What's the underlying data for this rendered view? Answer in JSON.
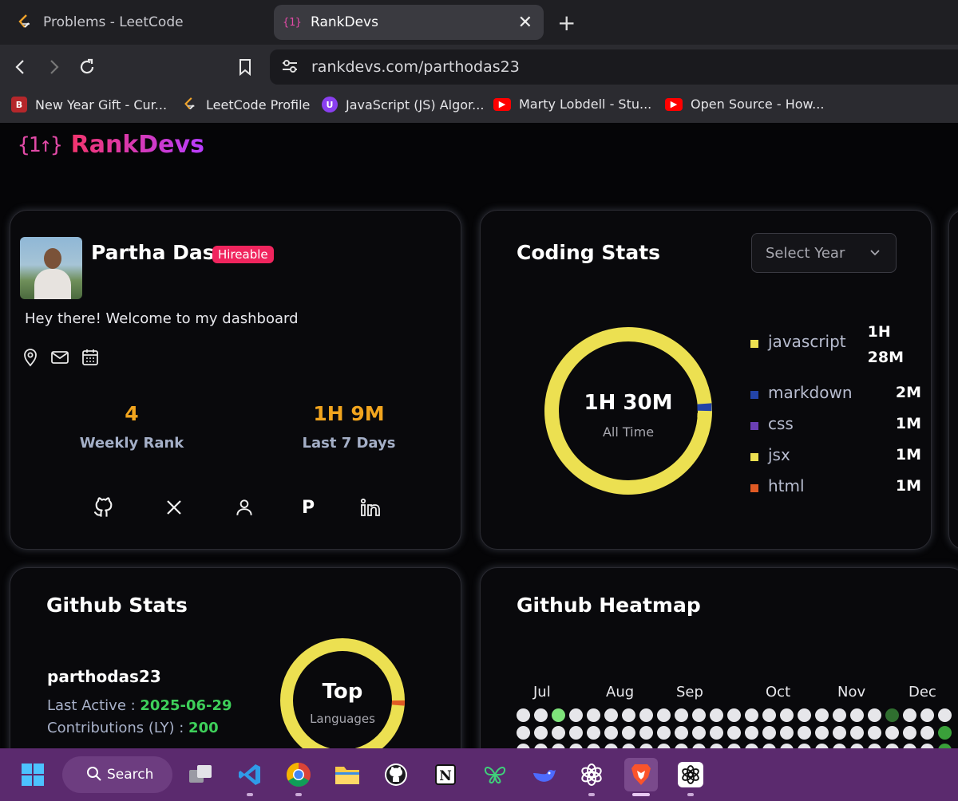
{
  "browser": {
    "tabs": [
      {
        "title": "Problems - LeetCode",
        "active": false
      },
      {
        "title": "RankDevs",
        "active": true
      }
    ],
    "url": "rankdevs.com/parthodas23",
    "bookmarks": [
      {
        "label": "New Year Gift - Cur...",
        "icon": "redbrand-icon"
      },
      {
        "label": "LeetCode Profile",
        "icon": "leetcode-icon"
      },
      {
        "label": "JavaScript (JS) Algor...",
        "icon": "udemy-icon"
      },
      {
        "label": "Marty Lobdell - Stu...",
        "icon": "youtube-icon"
      },
      {
        "label": "Open Source - How...",
        "icon": "youtube-icon"
      }
    ]
  },
  "site": {
    "logo_mark": "{1↑}",
    "name": "RankDevs"
  },
  "profile": {
    "name": "Partha Das",
    "badge": "Hireable",
    "bio": "Hey there! Welcome to my dashboard",
    "weekly_rank": "4",
    "weekly_rank_label": "Weekly Rank",
    "last7": "1H 9M",
    "last7_label": "Last 7 Days",
    "social_p": "P"
  },
  "coding_stats": {
    "title": "Coding Stats",
    "select_placeholder": "Select Year",
    "total": "1H 30M",
    "total_label": "All Time",
    "languages": [
      {
        "name": "javascript",
        "time_line1": "1H",
        "time_line2": "28M",
        "color": "#ece051"
      },
      {
        "name": "markdown",
        "time_line1": "2M",
        "time_line2": "",
        "color": "#2344a8"
      },
      {
        "name": "css",
        "time_line1": "1M",
        "time_line2": "",
        "color": "#6a3fb4"
      },
      {
        "name": "jsx",
        "time_line1": "1M",
        "time_line2": "",
        "color": "#ece051"
      },
      {
        "name": "html",
        "time_line1": "1M",
        "time_line2": "",
        "color": "#e05a24"
      }
    ]
  },
  "github_stats": {
    "title": "Github Stats",
    "username": "parthodas23",
    "last_active_label": "Last Active : ",
    "last_active": "2025-06-29",
    "contributions_label": "Contributions (LY) : ",
    "contributions": "200",
    "top_label": "Top",
    "top_sub": "Languages"
  },
  "heatmap": {
    "title": "Github Heatmap",
    "months": [
      "Jul",
      "Aug",
      "Sep",
      "Oct",
      "Nov",
      "Dec"
    ],
    "colors": {
      "empty": "#e6e6ea",
      "light": "#7ee37a",
      "dark": "#2f6e2f",
      "mid": "#3aa03a"
    }
  },
  "taskbar": {
    "search_label": "Search"
  }
}
